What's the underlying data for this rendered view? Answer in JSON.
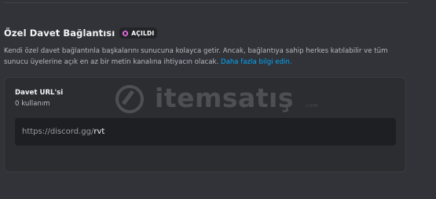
{
  "section": {
    "title": "Özel Davet Bağlantısı",
    "badge_label": "AÇILDI",
    "badge_icon": "boost-gem-icon",
    "badge_color": "#ff73fa",
    "description": "Kendi özel davet bağlantınla başkalarını sunucuna kolayca getir. Ancak, bağlantıya sahip herkes katılabilir ve tüm sunucu üyelerine açık en az bir metin kanalına ihtiyacın olacak.",
    "learn_more_link": "Daha fazla bilgi edin."
  },
  "card": {
    "title": "Davet URL'si",
    "usage": "0 kullanım",
    "url_prefix": "https://discord.gg/",
    "vanity_code": "rvt"
  },
  "watermark": {
    "brand": "itemsatış",
    "suffix": ".com"
  },
  "colors": {
    "background": "#313338",
    "card": "#2b2d31",
    "input": "#1e1f22",
    "link": "#00a8fc"
  }
}
